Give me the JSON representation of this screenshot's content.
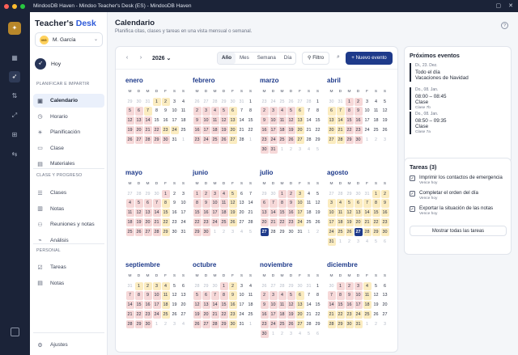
{
  "window": {
    "title": "MindooDB Haven - Mindoo Teacher's Desk (ES) - MindooDB Haven"
  },
  "brand": {
    "part1": "Teacher's ",
    "part2": "Desk"
  },
  "user": {
    "initials": "MG",
    "name": "M. García"
  },
  "sidebar": {
    "today": "Hoy",
    "section1": "PLANIFICAR E IMPARTIR",
    "items1": [
      {
        "label": "Calendario",
        "icon": "calendar-icon"
      },
      {
        "label": "Horario",
        "icon": "clock-icon"
      },
      {
        "label": "Planificación",
        "icon": "lightbulb-icon"
      },
      {
        "label": "Clase",
        "icon": "folder-icon"
      },
      {
        "label": "Materiales",
        "icon": "book-icon"
      }
    ],
    "section2": "CLASE Y PROGRESO",
    "items2": [
      {
        "label": "Clases",
        "icon": "list-icon"
      },
      {
        "label": "Notas",
        "icon": "chart-icon"
      },
      {
        "label": "Reuniones y notas",
        "icon": "meeting-icon"
      },
      {
        "label": "Análisis",
        "icon": "analysis-icon"
      }
    ],
    "section3": "PERSONAL",
    "items3": [
      {
        "label": "Tareas",
        "icon": "tasks-icon"
      },
      {
        "label": "Notas",
        "icon": "notes-icon"
      }
    ],
    "settings": "Ajustes"
  },
  "page": {
    "title": "Calendario",
    "subtitle": "Planifica citas, clases y tareas en una vista mensual o semanal."
  },
  "toolbar": {
    "year": "2026",
    "views": [
      "Año",
      "Mes",
      "Semana",
      "Día"
    ],
    "active_view": "Año",
    "filter": "Filtro",
    "new_event": "+ Nuevo evento"
  },
  "weekdays": [
    "M",
    "D",
    "M",
    "D",
    "F",
    "S",
    "S"
  ],
  "months": [
    {
      "name": "enero",
      "offset": 3,
      "days": 31,
      "red": [
        5,
        6,
        12,
        13,
        14,
        19,
        20,
        21,
        22,
        26,
        27,
        28,
        29,
        30
      ],
      "yellow": [
        1,
        2,
        7,
        23,
        24
      ]
    },
    {
      "name": "febrero",
      "offset": 6,
      "days": 28,
      "red": [
        2,
        3,
        4,
        5,
        9,
        10,
        11,
        12,
        16,
        17,
        18,
        19,
        23,
        24,
        25,
        26
      ],
      "yellow": [
        6,
        13,
        20,
        27
      ]
    },
    {
      "name": "marzo",
      "offset": 6,
      "days": 31,
      "red": [
        2,
        3,
        4,
        5,
        9,
        10,
        11,
        12,
        16,
        17,
        18,
        19,
        23,
        24,
        25,
        26,
        30,
        31
      ],
      "yellow": [
        6,
        13,
        20,
        27
      ]
    },
    {
      "name": "abril",
      "offset": 2,
      "days": 30,
      "red": [
        1,
        2,
        8,
        9,
        15,
        16,
        22,
        23,
        29,
        30
      ],
      "yellow": [
        6,
        7,
        13,
        14,
        20,
        21,
        27,
        28
      ]
    },
    {
      "name": "mayo",
      "offset": 4,
      "days": 31,
      "red": [
        1,
        4,
        5,
        6,
        7,
        11,
        12,
        13,
        14,
        18,
        19,
        20,
        21,
        25,
        26,
        27,
        28
      ],
      "yellow": [
        8,
        15,
        22,
        29
      ]
    },
    {
      "name": "junio",
      "offset": 0,
      "days": 30,
      "red": [
        1,
        2,
        3,
        4,
        8,
        9,
        10,
        11,
        15,
        16,
        17,
        18,
        22,
        23,
        24,
        25,
        29,
        30
      ],
      "yellow": [
        5,
        12,
        19,
        26
      ]
    },
    {
      "name": "julio",
      "offset": 2,
      "days": 31,
      "red": [
        1,
        2,
        6,
        7,
        8,
        9,
        13,
        14,
        15,
        16,
        20,
        21,
        22,
        23
      ],
      "yellow": [
        3,
        10,
        17,
        24
      ],
      "today": [
        27
      ]
    },
    {
      "name": "agosto",
      "offset": 5,
      "days": 31,
      "red": [],
      "yellow": [
        1,
        2,
        3,
        4,
        5,
        6,
        7,
        8,
        9,
        10,
        11,
        12,
        13,
        14,
        15,
        16,
        17,
        18,
        19,
        20,
        21,
        22,
        23,
        24,
        25,
        26,
        28,
        29,
        30,
        31
      ],
      "today": [
        27
      ]
    },
    {
      "name": "septiembre",
      "offset": 1,
      "days": 30,
      "red": [
        7,
        8,
        9,
        10,
        14,
        15,
        16,
        17,
        21,
        22,
        23,
        24,
        28,
        29,
        30
      ],
      "yellow": [
        1,
        2,
        3,
        4,
        11,
        18,
        25
      ]
    },
    {
      "name": "octubre",
      "offset": 3,
      "days": 31,
      "red": [
        1,
        5,
        6,
        7,
        8,
        12,
        13,
        14,
        15,
        19,
        20,
        21,
        22,
        26,
        27,
        28,
        29
      ],
      "yellow": [
        2,
        9,
        16,
        23,
        30
      ]
    },
    {
      "name": "noviembre",
      "offset": 6,
      "days": 30,
      "red": [
        2,
        3,
        4,
        5,
        9,
        10,
        11,
        12,
        16,
        17,
        18,
        19,
        23,
        24,
        25,
        26,
        30
      ],
      "yellow": [
        6,
        13,
        20,
        27
      ]
    },
    {
      "name": "diciembre",
      "offset": 1,
      "days": 31,
      "red": [
        1,
        2,
        3,
        7,
        8,
        9,
        10,
        14,
        15,
        16,
        17
      ],
      "yellow": [
        4,
        11,
        18,
        21,
        22,
        23,
        24,
        25,
        28,
        29,
        30,
        31
      ]
    }
  ],
  "upcoming": {
    "title": "Próximos eventos",
    "events": [
      {
        "date": "Di., 23. Dez.",
        "title1": "Todo el día",
        "title2": "Vacaciones de Navidad",
        "sub": ""
      },
      {
        "date": "Do., 08. Jan.",
        "title1": "08:00 – 08:45",
        "title2": "Clase",
        "sub": "Clase 7b"
      },
      {
        "date": "Do., 08. Jan.",
        "title1": "08:50 – 09:35",
        "title2": "Clase",
        "sub": "Clase 7a"
      }
    ]
  },
  "tasks": {
    "title": "Tareas (3)",
    "items": [
      {
        "label": "Imprimir los contactos de emergencia",
        "due": "Vence hoy"
      },
      {
        "label": "Completar el orden del día",
        "due": "Vence hoy"
      },
      {
        "label": "Exportar la situación de las notas",
        "due": "Vence hoy"
      }
    ],
    "show_all": "Mostrar todas las tareas"
  }
}
